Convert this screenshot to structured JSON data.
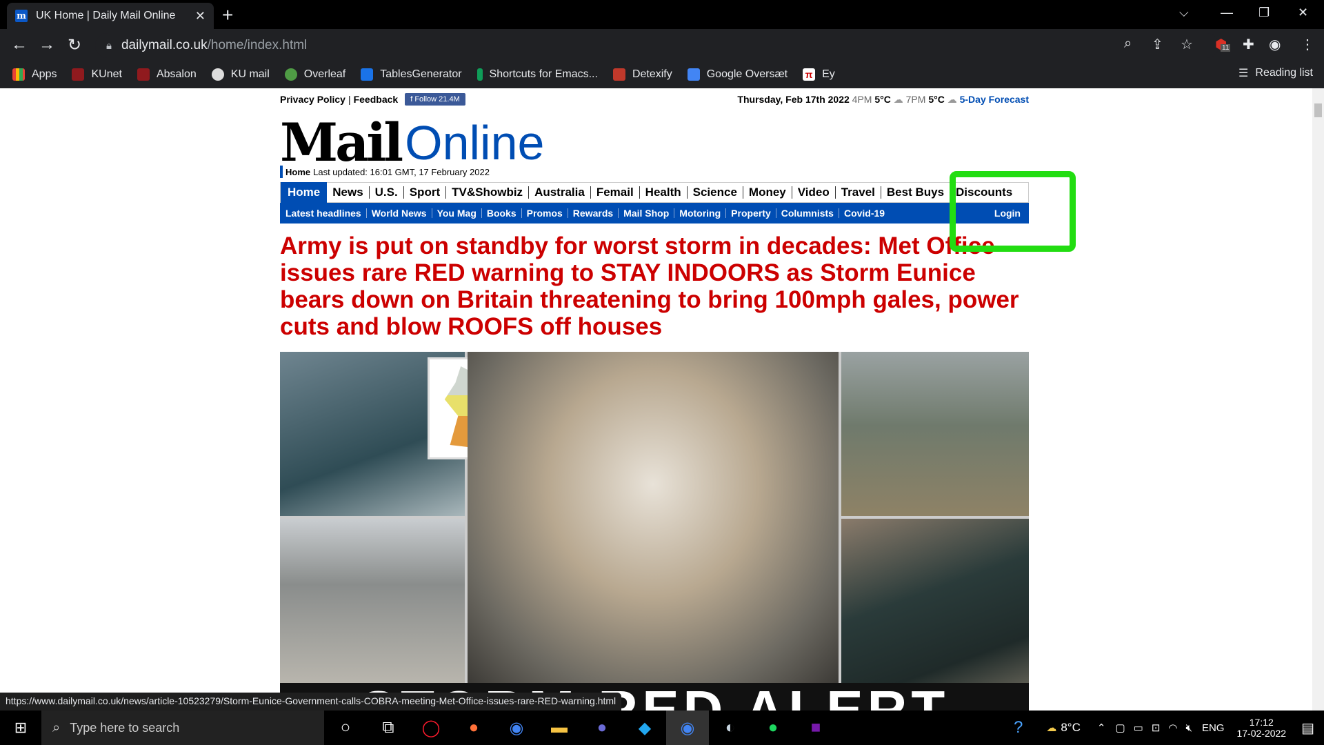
{
  "browser": {
    "tab_title": "UK Home | Daily Mail Online",
    "tab_favicon": "m",
    "url_host": "dailymail.co.uk",
    "url_path": "/home/index.html",
    "bookmarks": [
      "Apps",
      "KUnet",
      "Absalon",
      "KU mail",
      "Overleaf",
      "TablesGenerator",
      "Shortcuts for Emacs...",
      "Detexify",
      "Google Oversæt",
      "Ey"
    ],
    "reading_list": "Reading list",
    "extension_badge": "11"
  },
  "site": {
    "top_links": [
      "Privacy Policy",
      "Feedback"
    ],
    "fb_follow": "Follow 21.4M",
    "date": "Thursday, Feb 17th 2022",
    "w1_time": "4PM",
    "w1_temp": "5°C",
    "w2_time": "7PM",
    "w2_temp": "5°C",
    "forecast_link": "5-Day Forecast",
    "logo_mail": "Mail",
    "logo_online": "Online",
    "updated_home": "Home",
    "updated_text": "Last updated: 16:01 GMT, 17 February 2022",
    "nav_primary": [
      "Home",
      "News",
      "U.S.",
      "Sport",
      "TV&Showbiz",
      "Australia",
      "Femail",
      "Health",
      "Science",
      "Money",
      "Video",
      "Travel",
      "Best Buys",
      "Discounts"
    ],
    "nav_secondary": [
      "Latest headlines",
      "World News",
      "You Mag",
      "Books",
      "Promos",
      "Rewards",
      "Mail Shop",
      "Motoring",
      "Property",
      "Columnists",
      "Covid-19"
    ],
    "login": "Login",
    "headline": "Army is put on standby for worst storm in decades: Met Office issues rare RED warning to STAY INDOORS as Storm Eunice bears down on Britain threatening to bring 100mph gales, power cuts and blow ROOFS off houses",
    "banner_text": "STORM RED ALERT"
  },
  "status_url": "https://www.dailymail.co.uk/news/article-10523279/Storm-Eunice-Government-calls-COBRA-meeting-Met-Office-issues-rare-RED-warning.html",
  "taskbar": {
    "search_placeholder": "Type here to search",
    "temp": "8°C",
    "lang": "ENG",
    "time": "17:12",
    "date": "17-02-2022"
  },
  "colors": {
    "annotation_box": "#22dd11",
    "headline": "#cc0000",
    "brand_blue": "#004db3"
  }
}
